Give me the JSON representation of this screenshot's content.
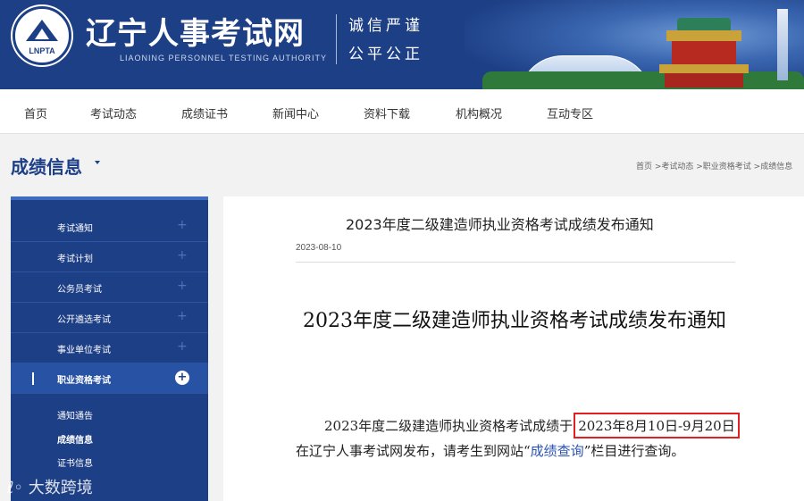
{
  "header": {
    "logo_text": "LNPTA",
    "site_title": "辽宁人事考试网",
    "site_subtitle": "LIAONING PERSONNEL TESTING AUTHORITY",
    "motto_line1": "诚信严谨",
    "motto_line2": "公平公正",
    "brand_color": "#1d3f86"
  },
  "nav": {
    "items": [
      "首页",
      "考试动态",
      "成绩证书",
      "新闻中心",
      "资料下载",
      "机构概况",
      "互动专区"
    ]
  },
  "section": {
    "title": "成绩信息",
    "breadcrumb": "首页 >考试动态 >职业资格考试 >成绩信息"
  },
  "sidebar": {
    "items": [
      {
        "label": "考试通知",
        "icon": "plus-icon"
      },
      {
        "label": "考试计划",
        "icon": "plus-icon"
      },
      {
        "label": "公务员考试",
        "icon": "plus-icon"
      },
      {
        "label": "公开遴选考试",
        "icon": "plus-icon"
      },
      {
        "label": "事业单位考试",
        "icon": "plus-icon"
      },
      {
        "label": "职业资格考试",
        "icon": "plus-circle-icon",
        "active": true
      }
    ],
    "sub_items": [
      {
        "label": "通知通告"
      },
      {
        "label": "成绩信息",
        "active": true
      },
      {
        "label": "证书信息"
      }
    ]
  },
  "watermark": "大数跨境",
  "article": {
    "title": "2023年度二级建造师执业资格考试成绩发布通知",
    "date": "2023-08-10",
    "heading": "2023年度二级建造师执业资格考试成绩发布通知",
    "para1_prefix": "2023年度二级建造师执业资格考试成绩于",
    "para1_highlight": "2023年8月10日-9月20日",
    "para2_prefix": "在辽宁人事考试网发布，请考生到网站“",
    "para2_link": "成绩查询",
    "para2_suffix": "”栏目进行查询。",
    "highlight_color": "#e02020",
    "link_color": "#2a52b6"
  }
}
